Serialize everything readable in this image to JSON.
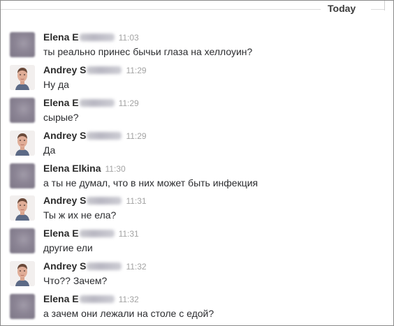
{
  "day_divider": {
    "label": "Today"
  },
  "messages": [
    {
      "author": "Elena E",
      "author_hidden": "lkina",
      "time": "11:03",
      "text": "ты реально принес бычьи глаза на хеллоуин?",
      "avatar": "blurred-avatar"
    },
    {
      "author": "Andrey S",
      "author_hidden": "urname",
      "time": "11:29",
      "text": "Ну да",
      "avatar": "male-face-avatar"
    },
    {
      "author": "Elena E",
      "author_hidden": "lkina",
      "time": "11:29",
      "text": "сырые?",
      "avatar": "blurred-avatar"
    },
    {
      "author": "Andrey S",
      "author_hidden": "urname",
      "time": "11:29",
      "text": "Да",
      "avatar": "male-face-avatar"
    },
    {
      "author": "Elena Elkina",
      "author_hidden": "",
      "time": "11:30",
      "text": "а ты не думал, что в них может быть инфекция",
      "avatar": "blurred-avatar"
    },
    {
      "author": "Andrey S",
      "author_hidden": "urname",
      "time": "11:31",
      "text": "Ты ж их не ела?",
      "avatar": "male-face-avatar"
    },
    {
      "author": "Elena E",
      "author_hidden": "lkina",
      "time": "11:31",
      "text": "другие ели",
      "avatar": "blurred-avatar"
    },
    {
      "author": "Andrey S",
      "author_hidden": "urname",
      "time": "11:32",
      "text": "Что?? Зачем?",
      "avatar": "male-face-avatar"
    },
    {
      "author": "Elena E",
      "author_hidden": "lkina",
      "time": "11:32",
      "text": "а зачем они лежали на столе с едой?",
      "avatar": "blurred-avatar"
    }
  ]
}
